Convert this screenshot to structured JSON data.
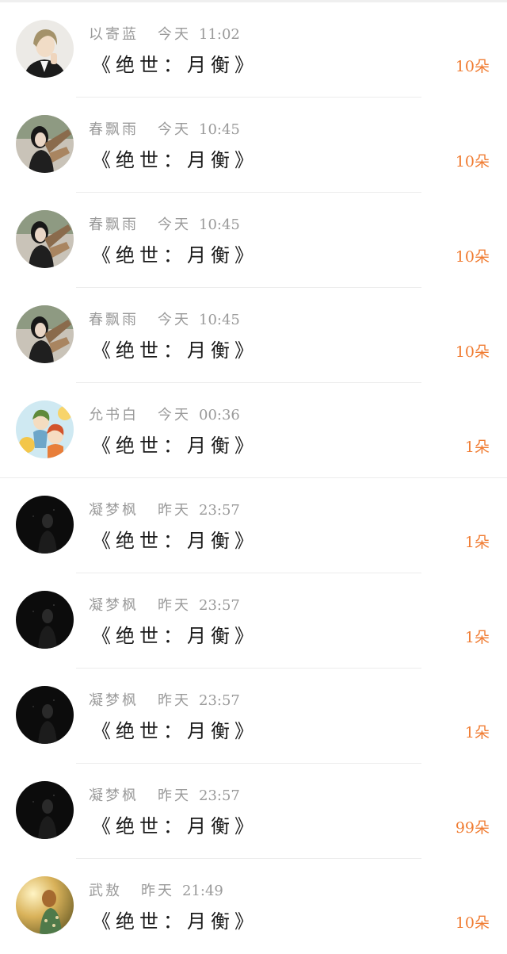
{
  "colors": {
    "meta": "#9a9a9a",
    "title": "#1a1a1a",
    "amount": "#f07c32",
    "divider": "#ececec"
  },
  "gifts": [
    {
      "user": "以寄蓝",
      "day": "今天",
      "time": "11:02",
      "title": "《绝世：月衡》",
      "amount": "10朵",
      "avatar": "avatar-anime-boy-icon"
    },
    {
      "user": "春飘雨",
      "day": "今天",
      "time": "10:45",
      "title": "《绝世：月衡》",
      "amount": "10朵",
      "avatar": "avatar-girl-photo-icon"
    },
    {
      "user": "春飘雨",
      "day": "今天",
      "time": "10:45",
      "title": "《绝世：月衡》",
      "amount": "10朵",
      "avatar": "avatar-girl-photo-icon"
    },
    {
      "user": "春飘雨",
      "day": "今天",
      "time": "10:45",
      "title": "《绝世：月衡》",
      "amount": "10朵",
      "avatar": "avatar-girl-photo-icon"
    },
    {
      "user": "允书白",
      "day": "今天",
      "time": "00:36",
      "title": "《绝世：月衡》",
      "amount": "1朵",
      "avatar": "avatar-cartoon-kids-icon"
    },
    {
      "user": "凝梦枫",
      "day": "昨天",
      "time": "23:57",
      "title": "《绝世：月衡》",
      "amount": "1朵",
      "avatar": "avatar-dark-icon"
    },
    {
      "user": "凝梦枫",
      "day": "昨天",
      "time": "23:57",
      "title": "《绝世：月衡》",
      "amount": "1朵",
      "avatar": "avatar-dark-icon"
    },
    {
      "user": "凝梦枫",
      "day": "昨天",
      "time": "23:57",
      "title": "《绝世：月衡》",
      "amount": "1朵",
      "avatar": "avatar-dark-icon"
    },
    {
      "user": "凝梦枫",
      "day": "昨天",
      "time": "23:57",
      "title": "《绝世：月衡》",
      "amount": "99朵",
      "avatar": "avatar-dark-icon"
    },
    {
      "user": "武敖",
      "day": "昨天",
      "time": "21:49",
      "title": "《绝世：月衡》",
      "amount": "10朵",
      "avatar": "avatar-sunset-girl-icon"
    }
  ]
}
